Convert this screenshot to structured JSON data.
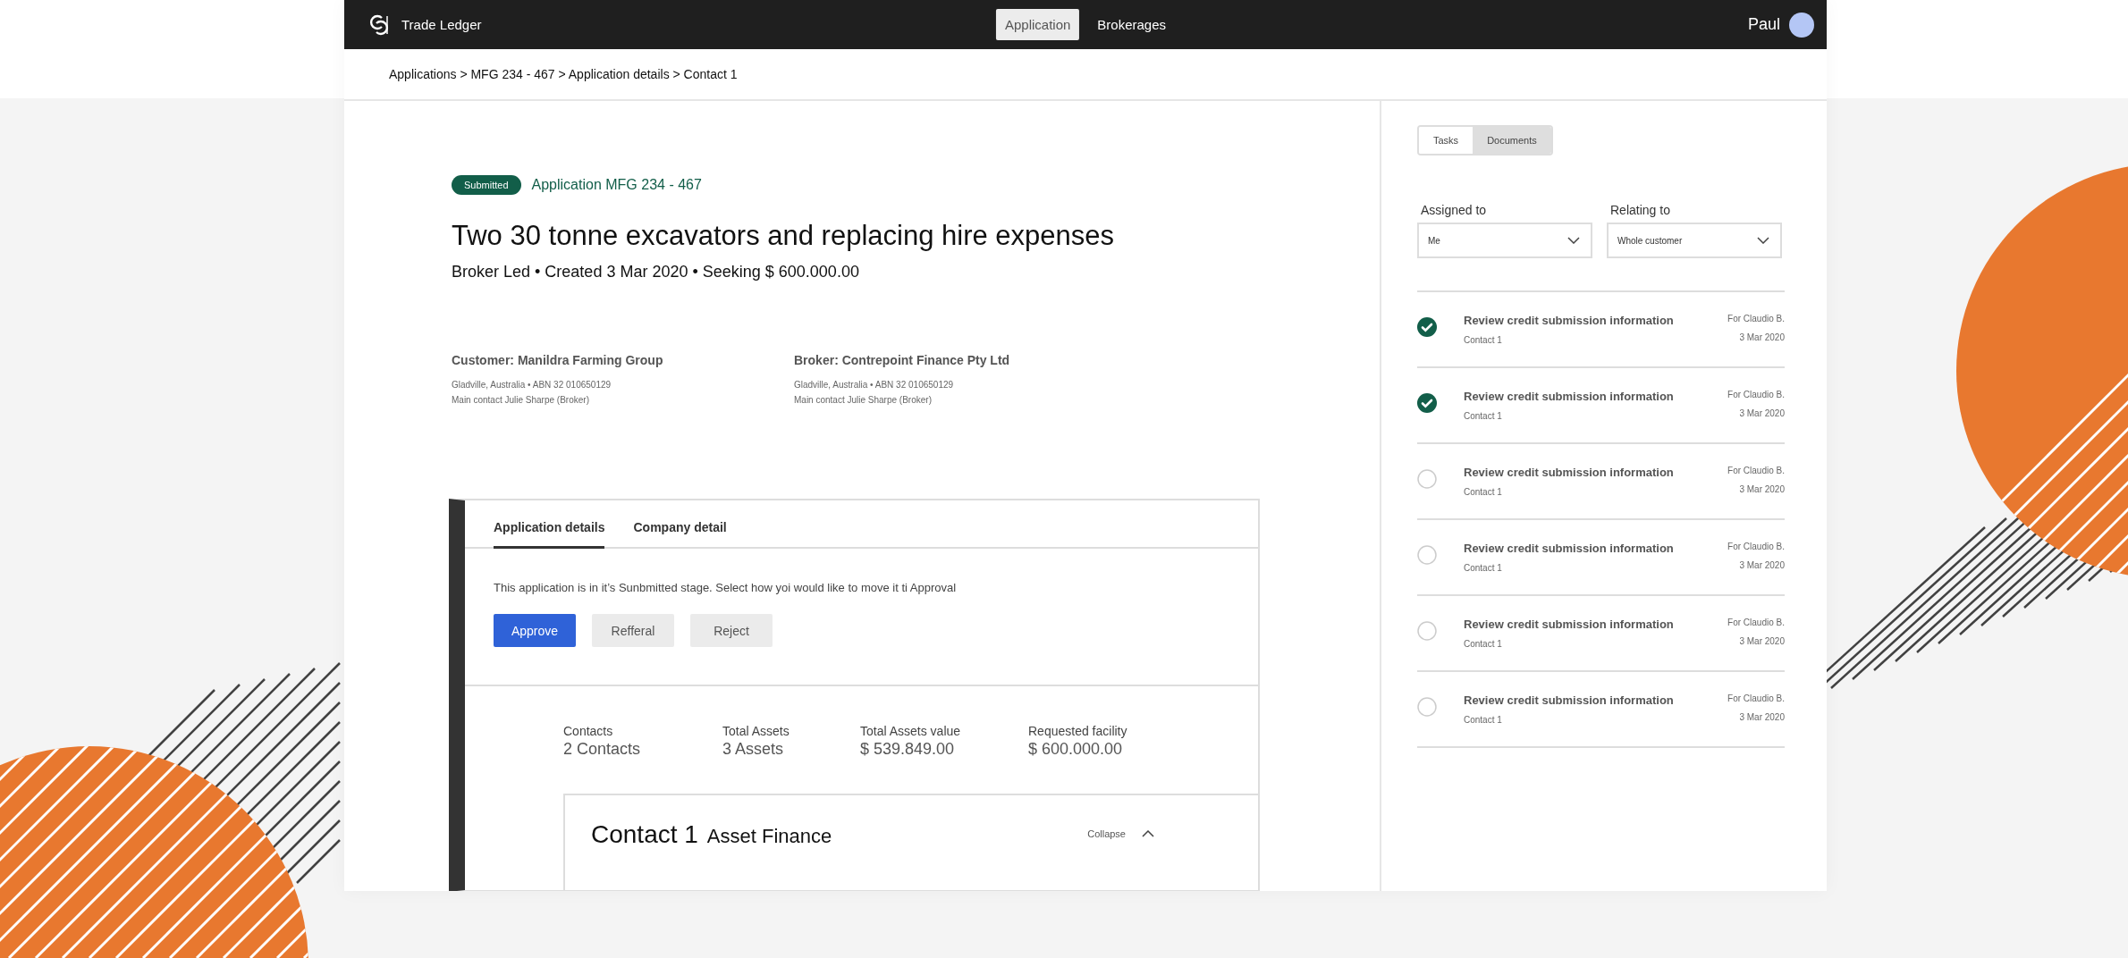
{
  "nav": {
    "brand": "Trade Ledger",
    "tabs": [
      {
        "label": "Application",
        "selected": true
      },
      {
        "label": "Brokerages",
        "selected": false
      }
    ],
    "user": "Paul"
  },
  "breadcrumb": "Applications > MFG 234 - 467 > Application details > Contact 1",
  "application": {
    "status": "Submitted",
    "reference": "Application MFG 234 - 467",
    "title": "Two 30 tonne excavators and replacing hire expenses",
    "subtitle": "Broker Led • Created 3 Mar 2020 • Seeking $ 600.000.00",
    "parties": [
      {
        "heading": "Customer: Manildra Farming Group",
        "lines": [
          "Gladville, Australia • ABN 32 010650129",
          "Main contact Julie Sharpe (Broker)"
        ]
      },
      {
        "heading": "Broker: Contrepoint Finance Pty Ltd",
        "lines": [
          "Gladville, Australia • ABN 32 010650129",
          "Main contact Julie Sharpe (Broker)"
        ]
      }
    ]
  },
  "card": {
    "tabs": [
      {
        "label": "Application details",
        "selected": true
      },
      {
        "label": "Company detail",
        "selected": false
      }
    ],
    "message": "This application is in it’s Sunbmitted stage. Select how yoi would like to move it ti Approval",
    "actions": [
      {
        "label": "Approve",
        "kind": "primary"
      },
      {
        "label": "Refferal",
        "kind": "secondary"
      },
      {
        "label": "Reject",
        "kind": "secondary"
      }
    ],
    "stats": [
      {
        "label": "Contacts",
        "value": "2 Contacts"
      },
      {
        "label": "Total Assets",
        "value": "3 Assets"
      },
      {
        "label": "Total Assets value",
        "value": "$ 539.849.00"
      },
      {
        "label": "Requested facility",
        "value": "$ 600.000.00"
      }
    ],
    "contact": {
      "title": "Contact 1",
      "subtitle": "Asset Finance",
      "toggle": "Collapse",
      "expanded": true
    }
  },
  "side": {
    "tabs": [
      {
        "label": "Tasks",
        "selected": true
      },
      {
        "label": "Documents",
        "selected": false
      }
    ],
    "filters": [
      {
        "label": "Assigned to",
        "value": "Me"
      },
      {
        "label": "Relating to",
        "value": "Whole customer"
      }
    ],
    "tasks": [
      {
        "title": "Review credit submission information",
        "contact": "Contact 1",
        "assignee": "For Claudio B.",
        "date": "3 Mar 2020",
        "done": true
      },
      {
        "title": "Review credit submission information",
        "contact": "Contact 1",
        "assignee": "For Claudio B.",
        "date": "3 Mar 2020",
        "done": true
      },
      {
        "title": "Review credit submission information",
        "contact": "Contact 1",
        "assignee": "For Claudio B.",
        "date": "3 Mar 2020",
        "done": false
      },
      {
        "title": "Review credit submission information",
        "contact": "Contact 1",
        "assignee": "For Claudio B.",
        "date": "3 Mar 2020",
        "done": false
      },
      {
        "title": "Review credit submission information",
        "contact": "Contact 1",
        "assignee": "For Claudio B.",
        "date": "3 Mar 2020",
        "done": false
      },
      {
        "title": "Review credit submission information",
        "contact": "Contact 1",
        "assignee": "For Claudio B.",
        "date": "3 Mar 2020",
        "done": false
      }
    ]
  }
}
